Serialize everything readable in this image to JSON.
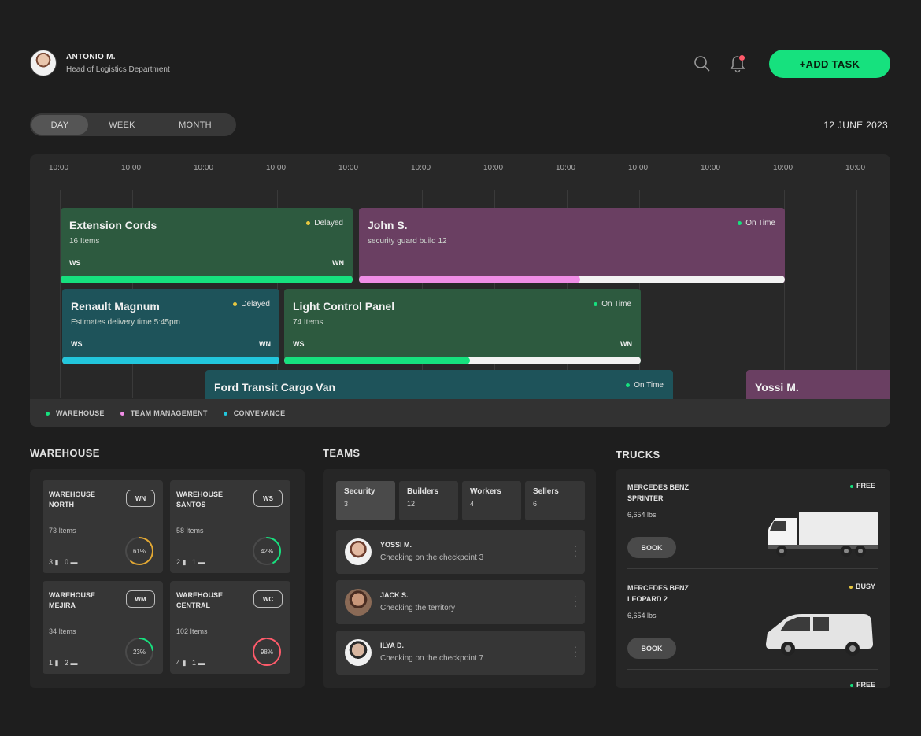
{
  "user": {
    "name": "ANTONIO M.",
    "role": "Head of Logistics Department"
  },
  "header": {
    "add_task": "+ADD TASK"
  },
  "view_tabs": [
    "DAY",
    "WEEK",
    "MONTH"
  ],
  "date": "12 JUNE 2023",
  "timeline": {
    "ticks": [
      "10:00",
      "10:00",
      "10:00",
      "10:00",
      "10:00",
      "10:00",
      "10:00",
      "10:00",
      "10:00",
      "10:00",
      "10:00",
      "10:00"
    ],
    "tasks": [
      {
        "title": "Extension Cords",
        "sub": "16 Items",
        "status": "Delayed",
        "from": "WS",
        "to": "WN",
        "progress": 100
      },
      {
        "title": "John S.",
        "sub": "security guard build 12",
        "status": "On Time",
        "progress": 52
      },
      {
        "title": "Renault Magnum",
        "sub": "Estimates delivery time 5:45pm",
        "status": "Delayed",
        "from": "WS",
        "to": "WN",
        "progress": 100
      },
      {
        "title": "Light Control Panel",
        "sub": "74 Items",
        "status": "On Time",
        "from": "WS",
        "to": "WN",
        "progress": 52
      },
      {
        "title": "Ford Transit Cargo Van",
        "status": "On Time"
      },
      {
        "title": "Yossi M."
      }
    ],
    "legend": [
      "WAREHOUSE",
      "TEAM MANAGEMENT",
      "CONVEYANCE"
    ]
  },
  "warehouse": {
    "title": "WAREHOUSE",
    "items": [
      {
        "name": "WAREHOUSE NORTH",
        "badge": "WN",
        "items": "73 Items",
        "a": "3",
        "b": "0",
        "pct": 61,
        "label": "61%"
      },
      {
        "name": "WAREHOUSE SANTOS",
        "badge": "WS",
        "items": "58 Items",
        "a": "2",
        "b": "1",
        "pct": 42,
        "label": "42%"
      },
      {
        "name": "WAREHOUSE MEJIRA",
        "badge": "WM",
        "items": "34 Items",
        "a": "1",
        "b": "2",
        "pct": 23,
        "label": "23%"
      },
      {
        "name": "WAREHOUSE CENTRAL",
        "badge": "WC",
        "items": "102 Items",
        "a": "4",
        "b": "1",
        "pct": 98,
        "label": "98%"
      }
    ]
  },
  "teams": {
    "title": "TEAMS",
    "tabs": [
      {
        "name": "Security",
        "count": "3"
      },
      {
        "name": "Builders",
        "count": "12"
      },
      {
        "name": "Workers",
        "count": "4"
      },
      {
        "name": "Sellers",
        "count": "6"
      }
    ],
    "members": [
      {
        "name": "YOSSI M.",
        "desc": "Checking on the checkpoint 3"
      },
      {
        "name": "JACK S.",
        "desc": "Checking the territory"
      },
      {
        "name": "ILYA D.",
        "desc": "Checking on the checkpoint 7"
      }
    ]
  },
  "trucks": {
    "title": "TRUCKS",
    "items": [
      {
        "name": "MERCEDES BENZ SPRINTER",
        "weight": "6,654 lbs",
        "status": "FREE",
        "book": "BOOK"
      },
      {
        "name": "MERCEDES BENZ LEOPARD 2",
        "weight": "6,654 lbs",
        "status": "BUSY",
        "book": "BOOK"
      },
      {
        "status": "FREE"
      }
    ]
  },
  "colors": {
    "accent": "#16e17e",
    "team": "#f08de6",
    "conveyance": "#22c6dc",
    "delayed": "#e8c840"
  }
}
